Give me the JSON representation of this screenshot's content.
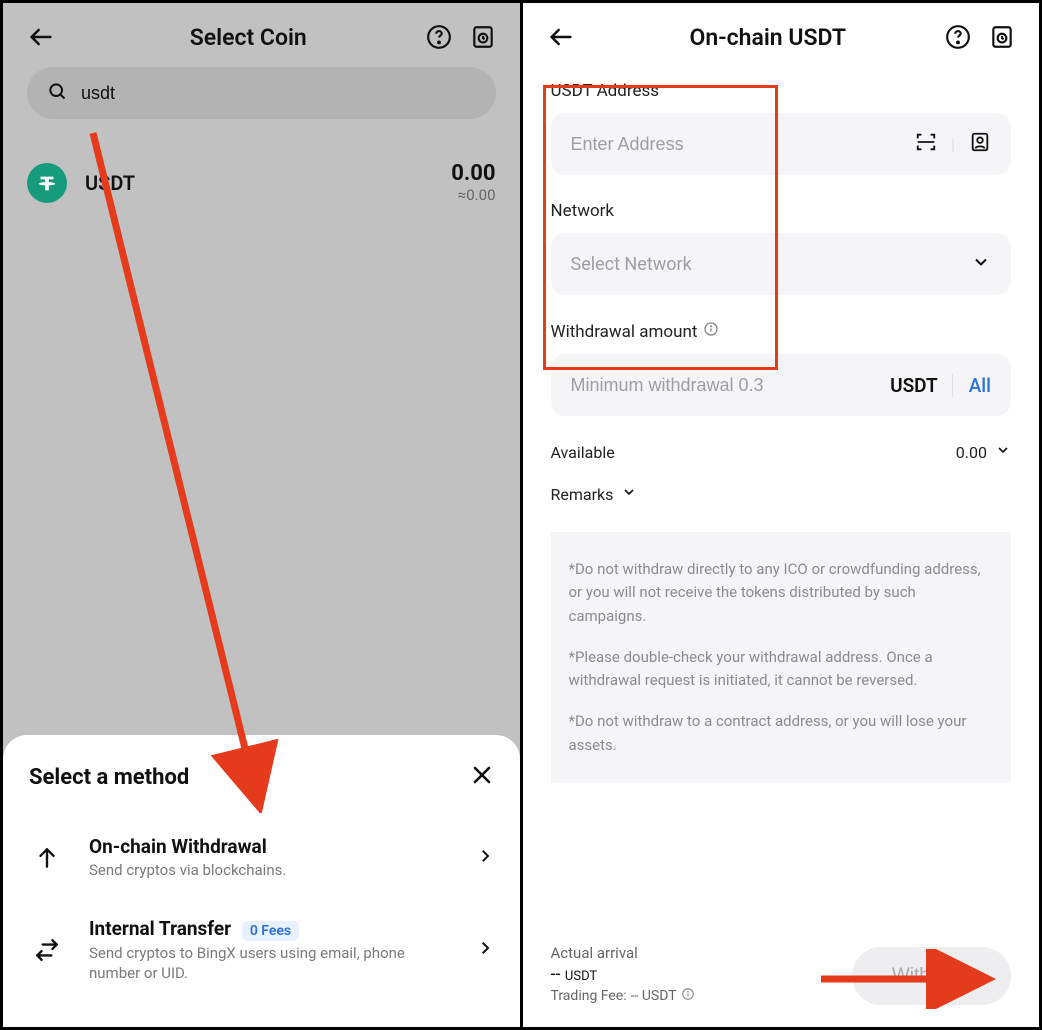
{
  "left": {
    "title": "Select Coin",
    "search_value": "usdt",
    "coin": {
      "symbol": "USDT",
      "amount": "0.00",
      "approx": "≈0.00"
    },
    "sheet": {
      "title": "Select a method",
      "methods": [
        {
          "name": "On-chain Withdrawal",
          "desc": "Send cryptos via blockchains.",
          "badge": ""
        },
        {
          "name": "Internal Transfer",
          "desc": "Send cryptos to BingX users using email, phone number or UID.",
          "badge": "0 Fees"
        }
      ]
    }
  },
  "right": {
    "title": "On-chain USDT",
    "address_label": "USDT Address",
    "address_placeholder": "Enter Address",
    "network_label": "Network",
    "network_placeholder": "Select Network",
    "amount_label": "Withdrawal amount",
    "amount_placeholder": "Minimum withdrawal 0.3",
    "amount_unit": "USDT",
    "all_label": "All",
    "available_label": "Available",
    "available_value": "0.00",
    "remarks_label": "Remarks",
    "notices": [
      "*Do not withdraw directly to any ICO or crowdfunding address, or you will not receive the tokens distributed by such campaigns.",
      "*Please double-check your withdrawal address. Once a withdrawal request is initiated, it cannot be reversed.",
      "*Do not withdraw to a contract address, or you will lose your assets."
    ],
    "arrival_label": "Actual arrival",
    "arrival_value": "--",
    "arrival_unit": "USDT",
    "fee_label": "Trading Fee:",
    "fee_value": "-- USDT",
    "withdraw_button": "Withdraw"
  }
}
